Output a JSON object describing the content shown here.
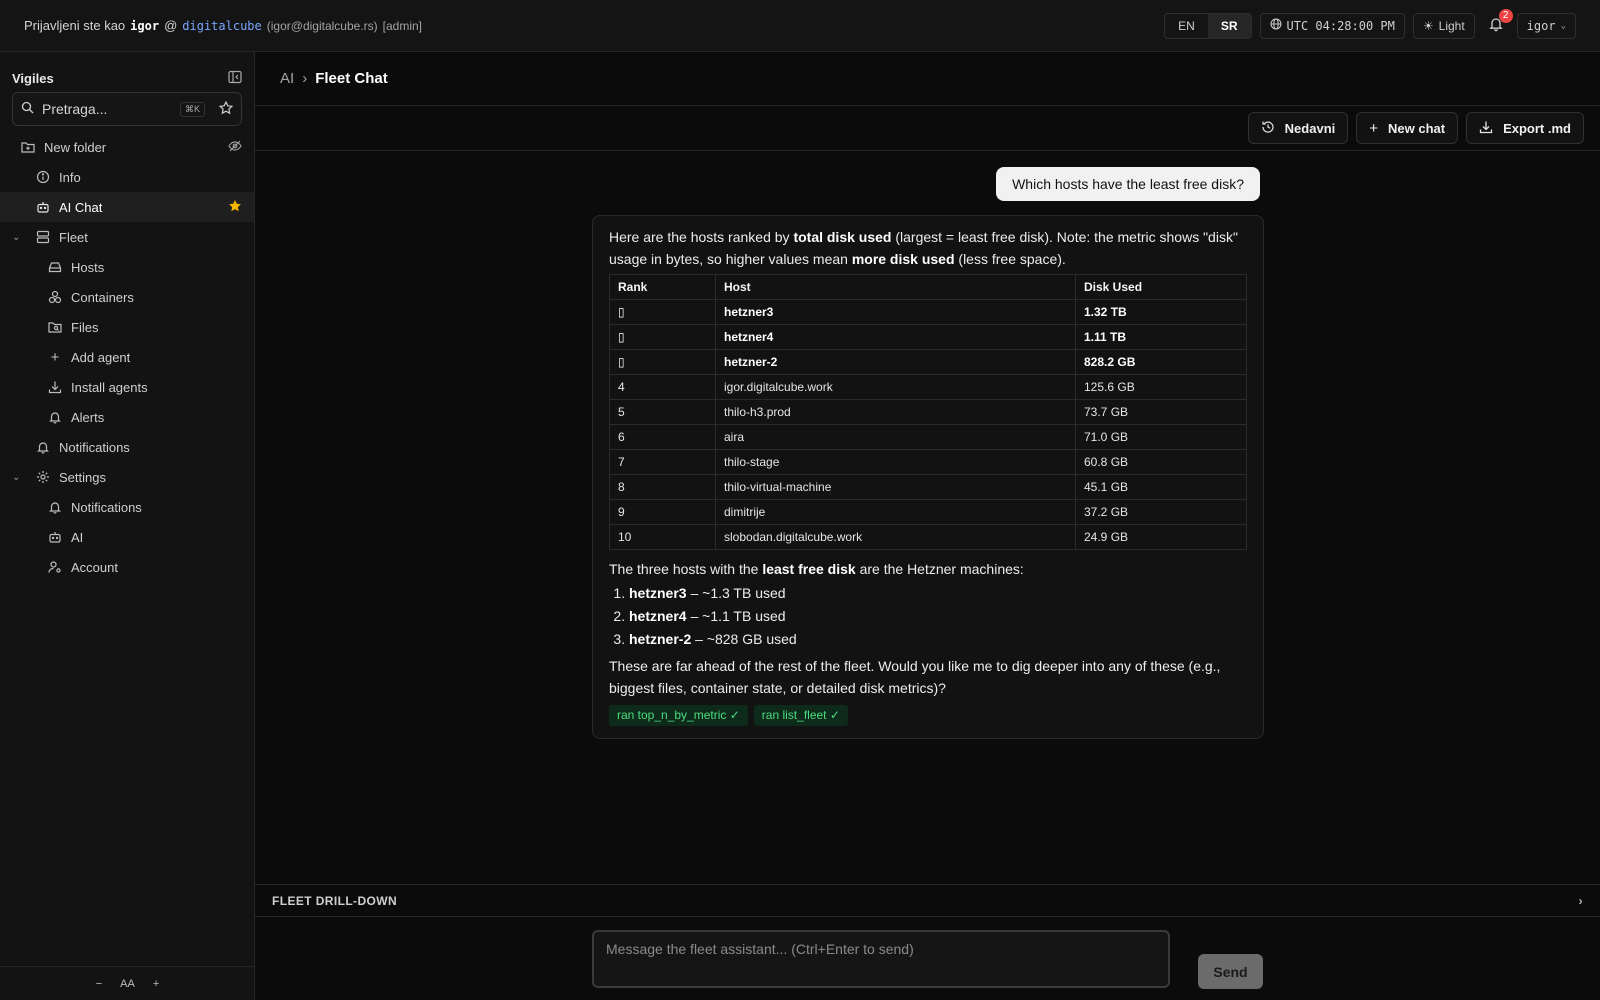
{
  "topbar": {
    "prefix": "Prijavljeni ste kao",
    "user": "igor",
    "at": "@",
    "org": "digitalcube",
    "email": "(igor@digitalcube.rs)",
    "role": "[admin]",
    "lang_en": "EN",
    "lang_sr": "SR",
    "time": "UTC 04:28:00 PM",
    "theme": "Light",
    "notif_count": "2",
    "user_menu": "igor"
  },
  "sidebar": {
    "title": "Vigiles",
    "search_placeholder": "Pretraga...",
    "search_kbd": "⌘K",
    "folder": "New folder",
    "items": {
      "info": "Info",
      "ai_chat": "AI Chat",
      "fleet": "Fleet",
      "hosts": "Hosts",
      "containers": "Containers",
      "files": "Files",
      "add_agent": "Add agent",
      "install_agents": "Install agents",
      "alerts": "Alerts",
      "notifications": "Notifications",
      "settings": "Settings",
      "set_notifications": "Notifications",
      "set_ai": "AI",
      "account": "Account"
    },
    "font_minus": "−",
    "font_label": "AA",
    "font_plus": "+"
  },
  "breadcrumb": {
    "parent": "AI",
    "sep": "›",
    "current": "Fleet Chat"
  },
  "toolbar": {
    "recent": "Nedavni",
    "new_chat": "New chat",
    "export": "Export .md"
  },
  "chat": {
    "user_message": "Which hosts have the least free disk?",
    "intro": {
      "p1": "Here are the hosts ranked by ",
      "b1": "total disk used",
      "p2": " (largest = least free disk). Note: the metric shows \"disk\" usage in bytes, so higher values mean ",
      "b2": "more disk used",
      "p3": " (less free space)."
    },
    "table": {
      "headers": [
        "Rank",
        "Host",
        "Disk Used"
      ],
      "rows": [
        [
          "",
          "hetzner3",
          "1.32 TB"
        ],
        [
          "",
          "hetzner4",
          "1.11 TB"
        ],
        [
          "",
          "hetzner-2",
          "828.2 GB"
        ],
        [
          "4",
          "igor.digitalcube.work",
          "125.6 GB"
        ],
        [
          "5",
          "thilo-h3.prod",
          "73.7 GB"
        ],
        [
          "6",
          "aira",
          "71.0 GB"
        ],
        [
          "7",
          "thilo-stage",
          "60.8 GB"
        ],
        [
          "8",
          "thilo-virtual-machine",
          "45.1 GB"
        ],
        [
          "9",
          "dimitrije",
          "37.2 GB"
        ],
        [
          "10",
          "slobodan.digitalcube.work",
          "24.9 GB"
        ]
      ]
    },
    "summary": {
      "p1": "The three hosts with the ",
      "b1": "least free disk",
      "p2": " are the Hetzner machines:"
    },
    "list": [
      {
        "host": "hetzner3",
        "text": " – ~1.3 TB used"
      },
      {
        "host": "hetzner4",
        "text": " – ~1.1 TB used"
      },
      {
        "host": "hetzner-2",
        "text": " – ~828 GB used"
      }
    ],
    "closing": "These are far ahead of the rest of the fleet. Would you like me to dig deeper into any of these (e.g., biggest files, container state, or detailed disk metrics)?",
    "tags": [
      "ran top_n_by_metric ✓",
      "ran list_fleet ✓"
    ]
  },
  "drill": {
    "label": "FLEET DRILL-DOWN"
  },
  "composer": {
    "placeholder": "Message the fleet assistant... (Ctrl+Enter to send)",
    "send": "Send"
  },
  "colors": {
    "accent_green": "#4ade80",
    "star": "#f5b400",
    "link": "#7aa7ff",
    "badge": "#ef4444"
  }
}
